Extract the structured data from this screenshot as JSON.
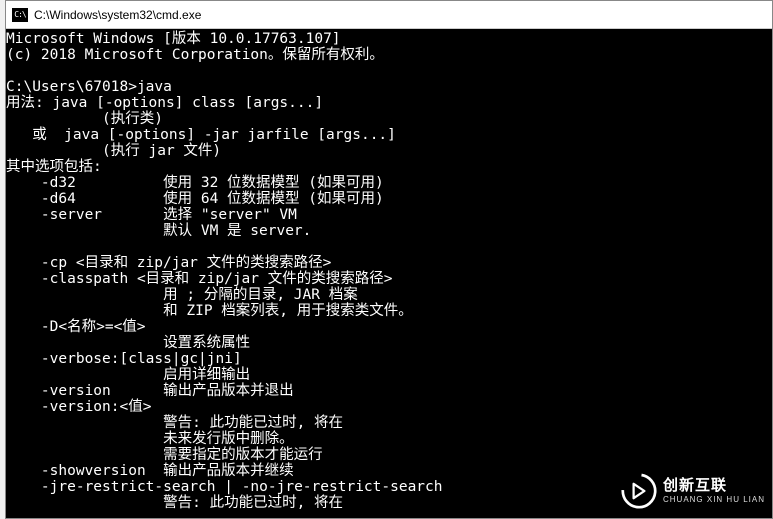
{
  "window": {
    "title": "C:\\Windows\\system32\\cmd.exe",
    "icon_label": "cmd-icon"
  },
  "terminal": {
    "lines": [
      "Microsoft Windows [版本 10.0.17763.107]",
      "(c) 2018 Microsoft Corporation。保留所有权利。",
      "",
      "C:\\Users\\67018>java",
      "用法: java [-options] class [args...]",
      "           (执行类)",
      "   或  java [-options] -jar jarfile [args...]",
      "           (执行 jar 文件)",
      "其中选项包括:",
      "    -d32          使用 32 位数据模型 (如果可用)",
      "    -d64          使用 64 位数据模型 (如果可用)",
      "    -server       选择 \"server\" VM",
      "                  默认 VM 是 server.",
      "",
      "    -cp <目录和 zip/jar 文件的类搜索路径>",
      "    -classpath <目录和 zip/jar 文件的类搜索路径>",
      "                  用 ; 分隔的目录, JAR 档案",
      "                  和 ZIP 档案列表, 用于搜索类文件。",
      "    -D<名称>=<值>",
      "                  设置系统属性",
      "    -verbose:[class|gc|jni]",
      "                  启用详细输出",
      "    -version      输出产品版本并退出",
      "    -version:<值>",
      "                  警告: 此功能已过时, 将在",
      "                  未来发行版中删除。",
      "                  需要指定的版本才能运行",
      "    -showversion  输出产品版本并继续",
      "    -jre-restrict-search | -no-jre-restrict-search",
      "                  警告: 此功能已过时, 将在"
    ]
  },
  "watermark": {
    "brand": "创新互联",
    "sub": "CHUANG XIN HU LIAN"
  }
}
